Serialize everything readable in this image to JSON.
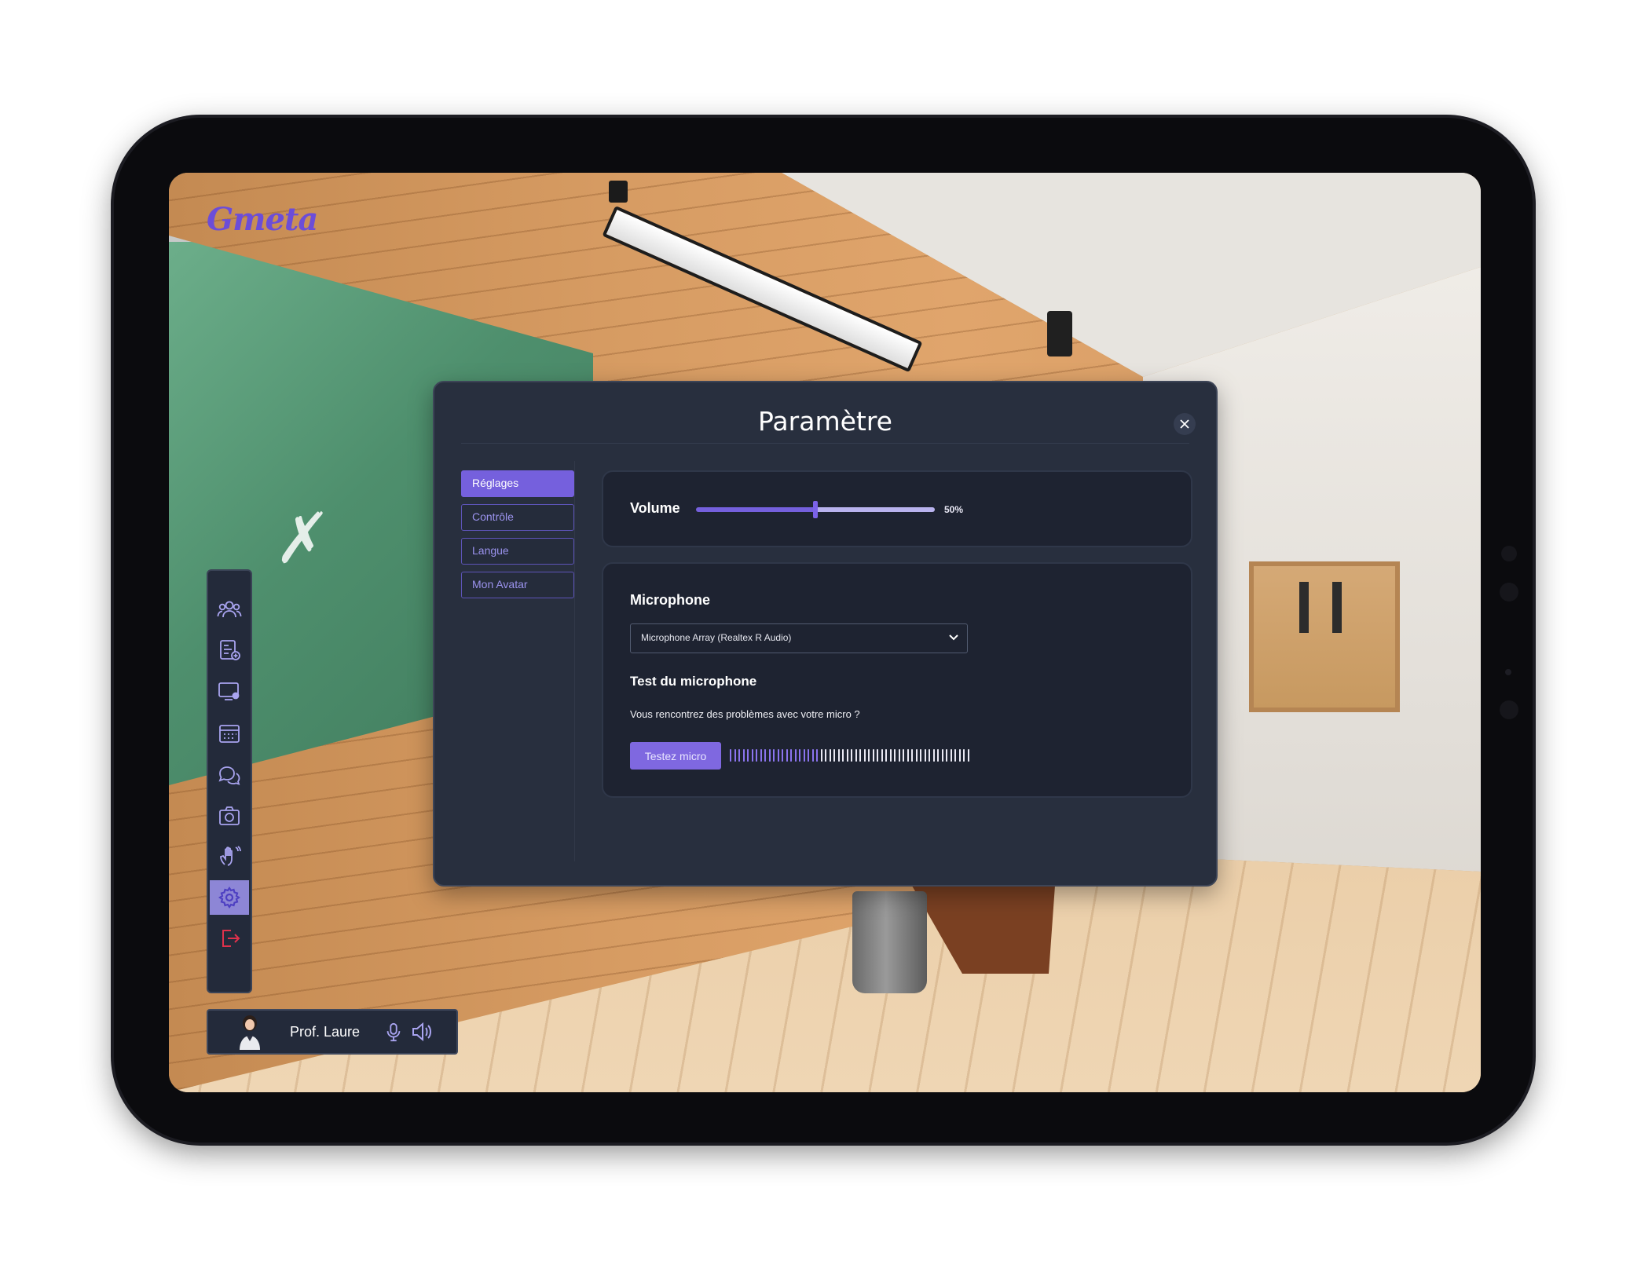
{
  "app": {
    "logo_text": "Gmeta",
    "accent_color": "#7560dd"
  },
  "toolbar": {
    "items": [
      {
        "name": "participants-icon",
        "active": false
      },
      {
        "name": "add-content-icon",
        "active": false
      },
      {
        "name": "screen-share-icon",
        "active": false
      },
      {
        "name": "calendar-icon",
        "active": false
      },
      {
        "name": "chat-icon",
        "active": false
      },
      {
        "name": "camera-icon",
        "active": false
      },
      {
        "name": "raise-hand-icon",
        "active": false
      },
      {
        "name": "settings-icon",
        "active": true
      },
      {
        "name": "logout-icon",
        "active": false
      }
    ]
  },
  "user": {
    "name": "Prof. Laure",
    "mic_icon": "microphone-icon",
    "speaker_icon": "speaker-icon"
  },
  "modal": {
    "title": "Paramètre",
    "close_icon": "close-icon",
    "nav": [
      {
        "label": "Réglages",
        "active": true
      },
      {
        "label": "Contrôle",
        "active": false
      },
      {
        "label": "Langue",
        "active": false
      },
      {
        "label": "Mon Avatar",
        "active": false
      }
    ],
    "volume": {
      "label": "Volume",
      "value_text": "50%",
      "level": 0.5
    },
    "microphone": {
      "label": "Microphone",
      "selected_device": "Microphone Array (Realtex R Audio)",
      "test_title": "Test du microphone",
      "test_question": "Vous rencontrez des problèmes avec votre micro ?",
      "test_button": "Testez micro",
      "meter_level": 0.38
    }
  }
}
